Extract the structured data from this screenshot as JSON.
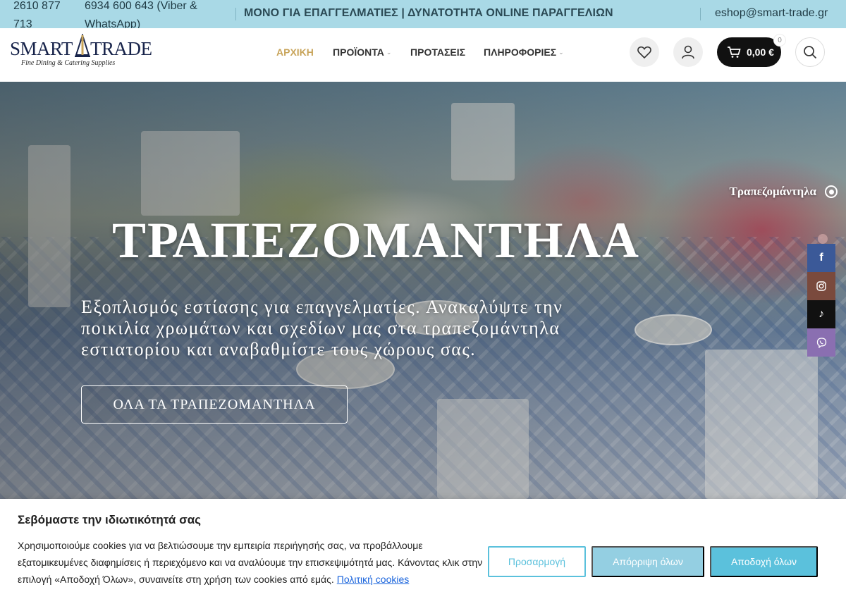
{
  "topbar": {
    "phone1": "2610 877 713",
    "phone2": "6934 600 643 (Viber & WhatsApp)",
    "promo": "ΜΟΝΟ ΓΙΑ ΕΠΑΓΓΕΛΜΑΤΙΕΣ | ΔΥΝΑΤΟΤΗΤΑ ONLINE ΠΑΡΑΓΓΕΛΙΩΝ",
    "email": "eshop@smart-trade.gr"
  },
  "header": {
    "logo_left": "SMART",
    "logo_right": "TRADE",
    "logo_tagline": "Fine Dining & Catering Supplies",
    "nav": [
      {
        "label": "ΑΡΧΙΚΗ",
        "active": true
      },
      {
        "label": "ΠΡΟΪΟΝΤΑ",
        "has_dropdown": true
      },
      {
        "label": "ΠΡΟΤΑΣΕΙΣ"
      },
      {
        "label": "ΠΛΗΡΟΦΟΡΙΕΣ",
        "has_dropdown": true
      }
    ],
    "cart_total": "0,00 €",
    "cart_count": "0",
    "icons": [
      "heart-icon",
      "user-icon",
      "cart-icon",
      "search-icon"
    ]
  },
  "hero": {
    "title": "ΤΡΑΠΕΖΟΜΑΝΤΗΛΑ",
    "text": "Εξοπλισμός εστίασης για επαγγελματίες. Ανακαλύψτε την ποικιλία χρωμάτων και σχεδίων μας στα τραπεζομάντηλα εστιατορίου και αναβαθμίστε τους χώρους σας.",
    "button": "ΟΛΑ ΤΑ ΤΡΑΠΕΖΟΜΑΝΤΗΛΑ",
    "slide_label": "Τραπεζομάντηλα"
  },
  "social": [
    {
      "name": "facebook-icon",
      "glyph": "f",
      "color": "#3b5998"
    },
    {
      "name": "instagram-icon",
      "color": "#7a4a3d"
    },
    {
      "name": "tiktok-icon",
      "glyph": "♪",
      "color": "#111111"
    },
    {
      "name": "viber-icon",
      "color": "#8a6fb1"
    }
  ],
  "cookie": {
    "title": "Σεβόμαστε την ιδιωτικότητά σας",
    "text": "Χρησιμοποιούμε cookies για να βελτιώσουμε την εμπειρία περιήγησής σας, να προβάλλουμε εξατομικευμένες διαφημίσεις ή περιεχόμενο και να αναλύουμε την επισκεψιμότητά μας. Κάνοντας κλικ στην επιλογή «Αποδοχή Όλων», συναινείτε στη χρήση των cookies από εμάς.",
    "policy_link": "Πολιτική cookies",
    "customize": "Προσαρμογή",
    "reject": "Απόρριψη όλων",
    "accept": "Αποδοχή όλων"
  },
  "colors": {
    "topbar_bg": "#a9d9e6",
    "nav_active": "#c8a45a",
    "cookie_accent": "#5bc1dc",
    "cookie_link": "#1863dc"
  }
}
